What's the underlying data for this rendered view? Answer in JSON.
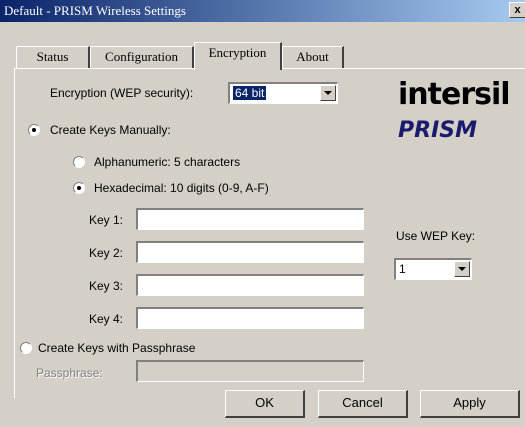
{
  "window": {
    "title": "Default - PRISM Wireless Settings",
    "close_symbol": "x"
  },
  "tabs": [
    {
      "label": "Status",
      "active": false
    },
    {
      "label": "Configuration",
      "active": false
    },
    {
      "label": "Encryption",
      "active": true
    },
    {
      "label": "About",
      "active": false
    }
  ],
  "encryption": {
    "wep_security_label": "Encryption (WEP security):",
    "wep_security_value": "64 bit",
    "create_manual_label": "Create Keys Manually:",
    "alphanumeric_label": "Alphanumeric: 5 characters",
    "hexadecimal_label": "Hexadecimal: 10 digits (0-9, A-F)",
    "keys": [
      {
        "label": "Key 1:",
        "value": ""
      },
      {
        "label": "Key 2:",
        "value": ""
      },
      {
        "label": "Key 3:",
        "value": ""
      },
      {
        "label": "Key 4:",
        "value": ""
      }
    ],
    "use_wep_key_label": "Use WEP Key:",
    "use_wep_key_value": "1",
    "passphrase_radio_label": "Create Keys with Passphrase",
    "passphrase_label": "Passphrase:",
    "passphrase_value": ""
  },
  "logos": {
    "intersil": "intersil",
    "prism": "PRISM"
  },
  "buttons": {
    "ok": "OK",
    "cancel": "Cancel",
    "apply": "Apply"
  }
}
